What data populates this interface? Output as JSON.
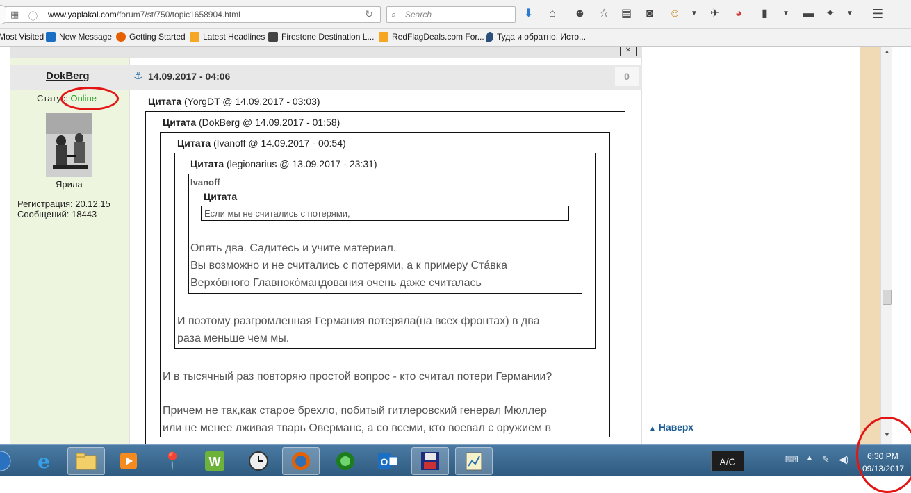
{
  "browser": {
    "url_host": "www.yaplakal.com",
    "url_path": "/forum7/st/750/topic1658904.html",
    "search_placeholder": "Search"
  },
  "bookmarks": [
    {
      "label": "Most Visited",
      "color": "#5b7fa6"
    },
    {
      "label": "New Message",
      "color": "#1a6fc4"
    },
    {
      "label": "Getting Started",
      "color": "#e66000"
    },
    {
      "label": "Latest Headlines",
      "color": "#f5a623"
    },
    {
      "label": "Firestone Destination L...",
      "color": "#444444"
    },
    {
      "label": "RedFlagDeals.com For...",
      "color": "#f5a623"
    },
    {
      "label": "Туда и обратно. Исто...",
      "color": "#2c4f7c"
    }
  ],
  "post": {
    "author": "DokBerg",
    "date": "14.09.2017 - 04:06",
    "count": "0",
    "status_label": "Статус:",
    "status_value": "Online",
    "nick": "Ярила",
    "registration": "Регистрация: 20.12.15",
    "messages": "Сообщений: 18443"
  },
  "quotes": [
    {
      "label": "Цитата",
      "meta": "(YorgDT @ 14.09.2017 - 03:03)"
    },
    {
      "label": "Цитата",
      "meta": "(DokBerg @ 14.09.2017 - 01:58)"
    },
    {
      "label": "Цитата",
      "meta": "(Ivanoff @ 14.09.2017 - 00:54)"
    },
    {
      "label": "Цитата",
      "meta": "(legionarius @ 13.09.2017 - 23:31)"
    }
  ],
  "nested": {
    "name": "Ivanoff",
    "quote_label": "Цитата",
    "quote_text": "Если мы не считались с потерями,",
    "reply_line1": "Опять два. Садитесь и учите материал.",
    "reply_line2": "Вы возможно и не считались с потерями, а к примеру Ста́вка",
    "reply_line3": "Верхо́вного Главноко́мандования очень даже считалась"
  },
  "text": {
    "germany_line1": "И поэтому разгромленная Германия потеряла(на всех фронтах) в два",
    "germany_line2": "раза меньше чем мы.",
    "question": "И в тысячный раз повторяю простой вопрос - кто считал потери Германии?",
    "para_line1": "Причем не так,как старое брехло, побитый гитлеровский генерал Мюллер",
    "para_line2": "или не менее лживая тварь Оверманс, а со всеми, кто воевал с оружием в"
  },
  "sidebar": {
    "to_top": "Наверх"
  },
  "taskbar": {
    "ac_label": "A/C",
    "time": "6:30 PM",
    "date": "09/13/2017"
  }
}
